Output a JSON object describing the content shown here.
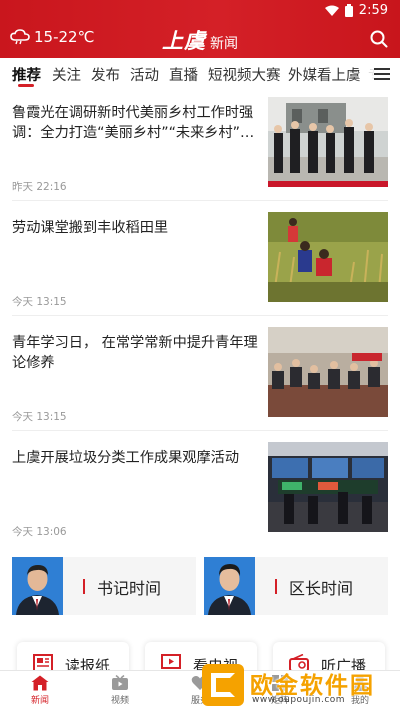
{
  "status_bar": {
    "time": "2:59"
  },
  "header": {
    "weather": "15-22℃",
    "logo_script": "上虞",
    "logo_news": "新闻",
    "brand_color": "#d42027"
  },
  "tabs": [
    "推荐",
    "关注",
    "发布",
    "活动",
    "直播",
    "短视频大赛",
    "外媒看上虞",
    "专"
  ],
  "active_tab": "推荐",
  "news": [
    {
      "title": "鲁霞光在调研新时代美丽乡村工作时强调：全力打造“美丽乡村”“未来乡村”示范…",
      "time": "昨天 22:16",
      "image": "officials-visit-photo"
    },
    {
      "title": "劳动课堂搬到丰收稻田里",
      "time": "今天 13:15",
      "image": "children-harvest-rice-photo"
    },
    {
      "title": "青年学习日， 在常学常新中提升青年理论修养",
      "time": "今天 13:15",
      "image": "youth-meeting-photo"
    },
    {
      "title": "上虞开展垃圾分类工作成果观摩活动",
      "time": "今天 13:06",
      "image": "control-room-photo"
    }
  ],
  "columns": [
    {
      "label": "书记时间",
      "image": "secretary-portrait"
    },
    {
      "label": "区长时间",
      "image": "mayor-portrait"
    }
  ],
  "services": [
    {
      "label": "读报纸",
      "icon": "newspaper-icon"
    },
    {
      "label": "看电视",
      "icon": "tv-icon"
    },
    {
      "label": "听广播",
      "icon": "radio-icon"
    }
  ],
  "bottom_nav": [
    {
      "label": "新闻",
      "icon": "home-icon"
    },
    {
      "label": "视频",
      "icon": "video-icon"
    },
    {
      "label": "服务",
      "icon": "heart-icon"
    },
    {
      "label": "矩阵",
      "icon": "grid-icon"
    },
    {
      "label": "我的",
      "icon": "user-icon"
    }
  ],
  "watermark": {
    "text": "欧金软件园",
    "url": "www.oupoujin.com"
  }
}
